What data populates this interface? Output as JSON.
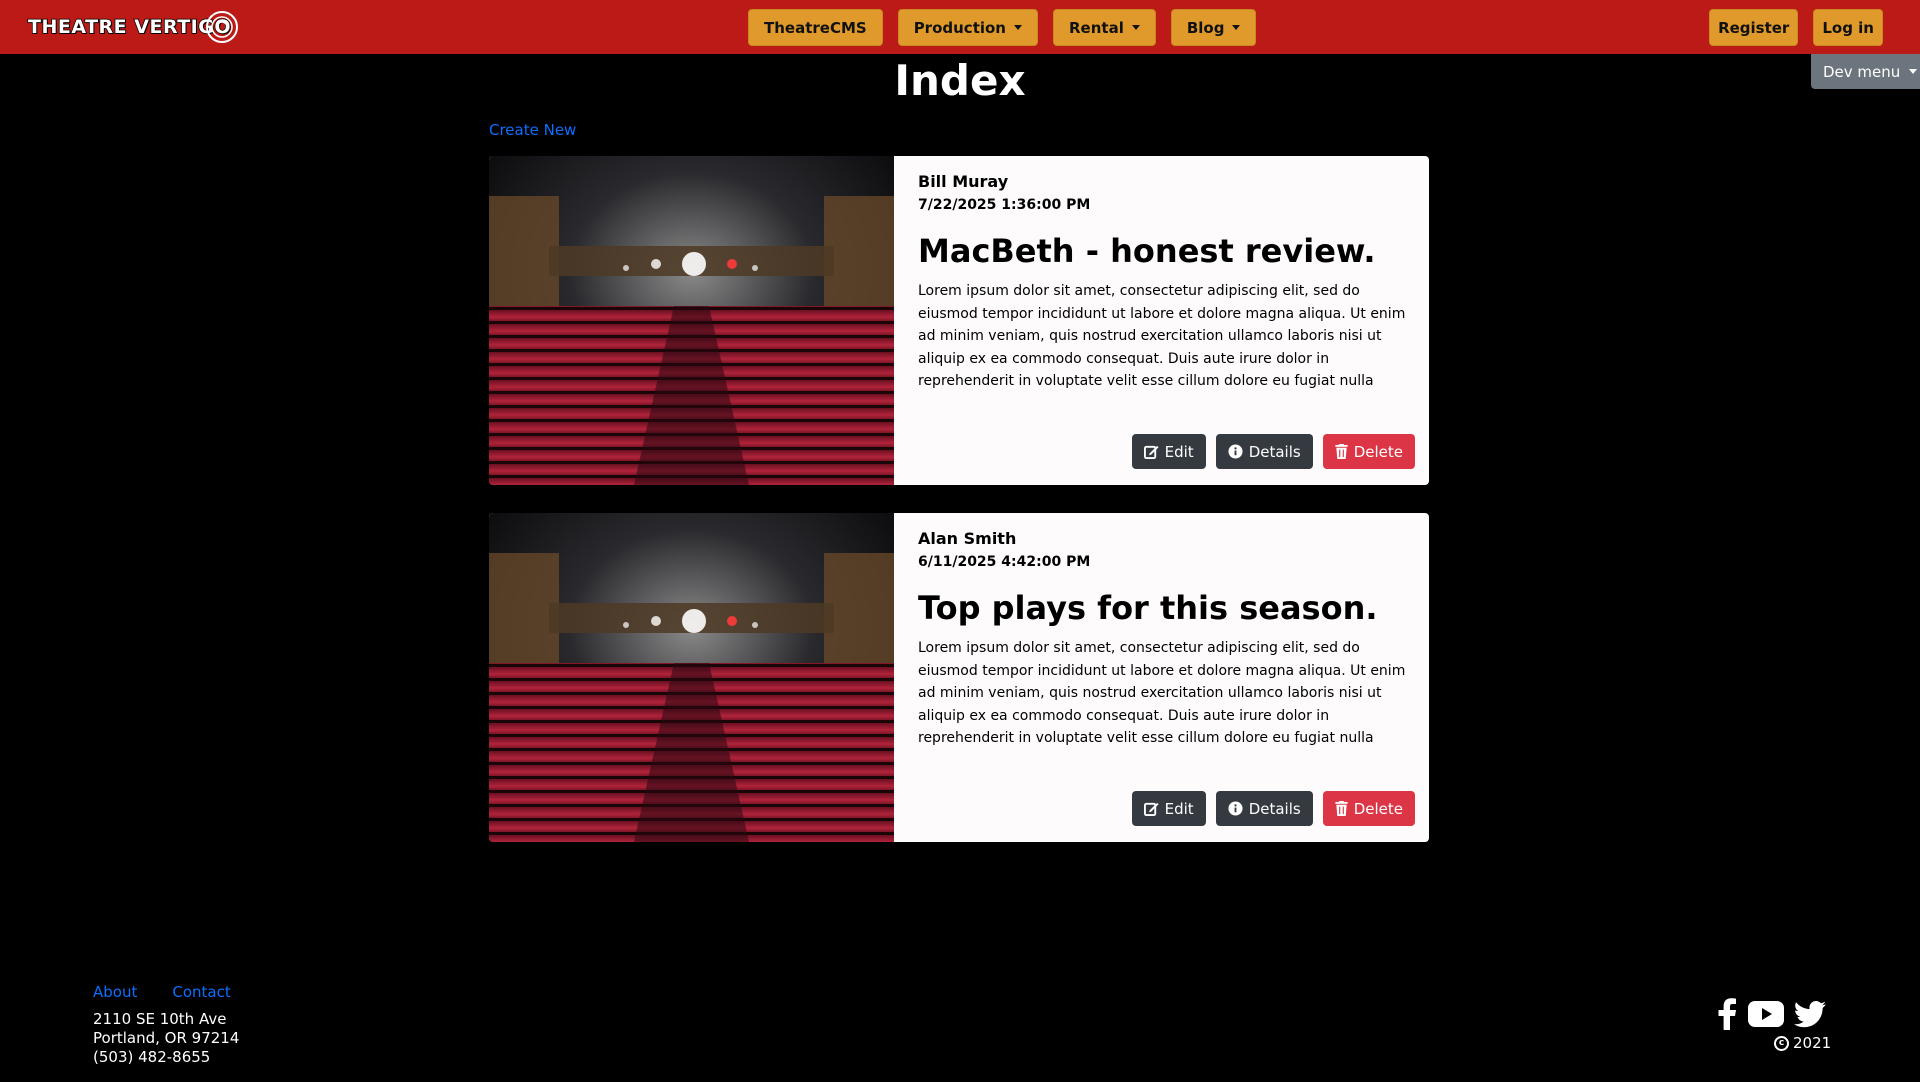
{
  "brand": {
    "name": "THEATRE VERTIGO"
  },
  "nav": {
    "items": [
      {
        "label": "TheatreCMS",
        "dropdown": false
      },
      {
        "label": "Production",
        "dropdown": true
      },
      {
        "label": "Rental",
        "dropdown": true
      },
      {
        "label": "Blog",
        "dropdown": true
      }
    ],
    "register": "Register",
    "login": "Log in"
  },
  "dev_menu": {
    "label": "Dev menu"
  },
  "page": {
    "title": "Index",
    "create_new": "Create New"
  },
  "posts": [
    {
      "author": "Bill Muray",
      "date": "7/22/2025 1:36:00 PM",
      "title": "MacBeth - honest review.",
      "text": "Lorem ipsum dolor sit amet, consectetur adipiscing elit, sed do eiusmod tempor incididunt ut labore et dolore magna aliqua. Ut enim ad minim veniam, quis nostrud exercitation ullamco laboris nisi ut aliquip ex ea commodo consequat. Duis aute irure dolor in reprehenderit in voluptate velit esse cillum dolore eu fugiat nulla pariatur. Excepteur sint occaecat...",
      "edit": "Edit",
      "details": "Details",
      "delete": "Delete"
    },
    {
      "author": "Alan Smith",
      "date": "6/11/2025 4:42:00 PM",
      "title": "Top plays for this season.",
      "text": "Lorem ipsum dolor sit amet, consectetur adipiscing elit, sed do eiusmod tempor incididunt ut labore et dolore magna aliqua. Ut enim ad minim veniam, quis nostrud exercitation ullamco laboris nisi ut aliquip ex ea commodo consequat. Duis aute irure dolor in reprehenderit in voluptate velit esse cillum dolore eu fugiat nulla pariatur. Excepteur sint occaecat...",
      "edit": "Edit",
      "details": "Details",
      "delete": "Delete"
    }
  ],
  "footer": {
    "about": "About",
    "contact": "Contact",
    "address_line1": "2110 SE 10th Ave",
    "address_line2": "Portland, OR 97214",
    "phone": "(503) 482-8655",
    "year": "2021",
    "social": [
      "facebook-icon",
      "youtube-icon",
      "twitter-icon"
    ]
  },
  "colors": {
    "navbar": "#bb1a16",
    "nav_button": "#df9a2b",
    "link": "#0d6efd",
    "danger": "#dc3545",
    "dark_button": "#343a40",
    "dev_menu": "#6c757d"
  }
}
